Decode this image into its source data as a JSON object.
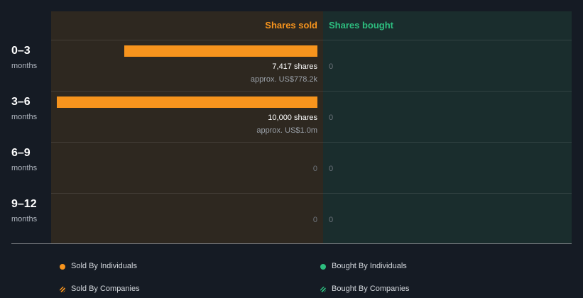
{
  "chart_data": {
    "type": "bar",
    "orientation": "horizontal",
    "columns": {
      "sold": "Shares sold",
      "bought": "Shares bought"
    },
    "categories": [
      {
        "period": "0–3",
        "unit": "months"
      },
      {
        "period": "3–6",
        "unit": "months"
      },
      {
        "period": "6–9",
        "unit": "months"
      },
      {
        "period": "9–12",
        "unit": "months"
      }
    ],
    "sold": [
      {
        "value": 7417,
        "shares_label": "7,417 shares",
        "approx_label": "approx. US$778.2k"
      },
      {
        "value": 10000,
        "shares_label": "10,000 shares",
        "approx_label": "approx. US$1.0m"
      },
      {
        "value": 0,
        "zero_label": "0"
      },
      {
        "value": 0,
        "zero_label": "0"
      }
    ],
    "bought": [
      {
        "value": 0,
        "zero_label": "0"
      },
      {
        "value": 0,
        "zero_label": "0"
      },
      {
        "value": 0,
        "zero_label": "0"
      },
      {
        "value": 0,
        "zero_label": "0"
      }
    ],
    "xlim": [
      0,
      10000
    ],
    "colors": {
      "sold": "#f7941d",
      "bought": "#2dbe7f"
    },
    "legend": [
      {
        "label": "Sold By Individuals",
        "color": "#f7941d",
        "style": "solid"
      },
      {
        "label": "Bought By Individuals",
        "color": "#2dbe7f",
        "style": "solid"
      },
      {
        "label": "Sold By Companies",
        "color": "#f7941d",
        "style": "hatched"
      },
      {
        "label": "Bought By Companies",
        "color": "#2dbe7f",
        "style": "hatched"
      }
    ]
  }
}
